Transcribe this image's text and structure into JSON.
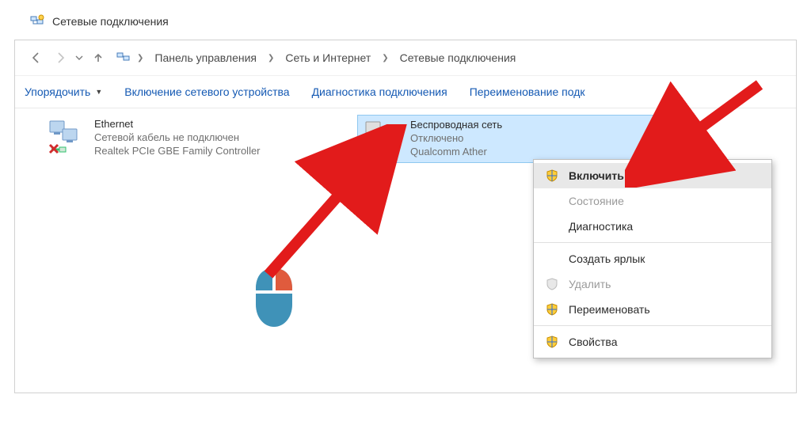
{
  "window": {
    "title": "Сетевые подключения"
  },
  "breadcrumbs": {
    "b0": "Панель управления",
    "b1": "Сеть и Интернет",
    "b2": "Сетевые подключения"
  },
  "toolbar": {
    "organize": "Упорядочить",
    "enable_device": "Включение сетевого устройства",
    "diagnose": "Диагностика подключения",
    "rename": "Переименование подк"
  },
  "connections": {
    "eth": {
      "name": "Ethernet",
      "status": "Сетевой кабель не подключен",
      "device": "Realtek PCIe GBE Family Controller"
    },
    "wifi": {
      "name": "Беспроводная сеть",
      "status": "Отключено",
      "device": "Qualcomm Ather"
    }
  },
  "context_menu": {
    "enable": "Включить",
    "state": "Состояние",
    "diagnose": "Диагностика",
    "shortcut": "Создать ярлык",
    "delete": "Удалить",
    "rename": "Переименовать",
    "properties": "Свойства"
  }
}
